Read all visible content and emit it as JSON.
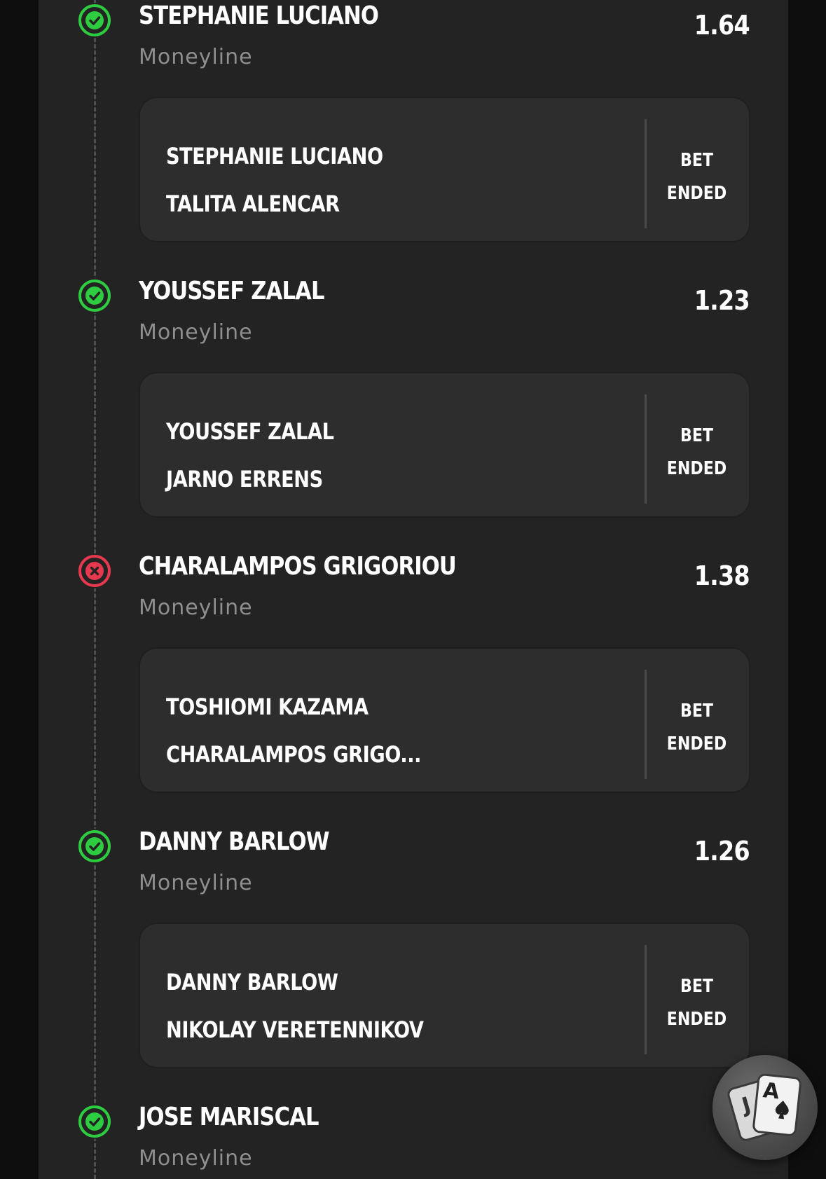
{
  "legs": [
    {
      "status": "won",
      "status_icon": "check-circle-icon",
      "pick": "STEPHANIE LUCIANO",
      "market": "Moneyline",
      "odds": "1.64",
      "fighter_1": "STEPHANIE LUCIANO",
      "fighter_2": "TALITA ALENCAR",
      "bet_status_line1": "BET",
      "bet_status_line2": "ENDED"
    },
    {
      "status": "won",
      "status_icon": "check-circle-icon",
      "pick": "YOUSSEF ZALAL",
      "market": "Moneyline",
      "odds": "1.23",
      "fighter_1": "YOUSSEF ZALAL",
      "fighter_2": "JARNO ERRENS",
      "bet_status_line1": "BET",
      "bet_status_line2": "ENDED"
    },
    {
      "status": "lost",
      "status_icon": "x-circle-icon",
      "pick": "CHARALAMPOS GRIGORIOU",
      "market": "Moneyline",
      "odds": "1.38",
      "fighter_1": "TOSHIOMI KAZAMA",
      "fighter_2": "CHARALAMPOS GRIGO...",
      "bet_status_line1": "BET",
      "bet_status_line2": "ENDED"
    },
    {
      "status": "won",
      "status_icon": "check-circle-icon",
      "pick": "DANNY BARLOW",
      "market": "Moneyline",
      "odds": "1.26",
      "fighter_1": "DANNY BARLOW",
      "fighter_2": "NIKOLAY VERETENNIKOV",
      "bet_status_line1": "BET",
      "bet_status_line2": "ENDED"
    },
    {
      "status": "won",
      "status_icon": "check-circle-icon",
      "pick": "JOSE MARISCAL",
      "market": "Moneyline",
      "odds": "1.",
      "fighter_1": "",
      "fighter_2": "",
      "bet_status_line1": "",
      "bet_status_line2": ""
    }
  ],
  "colors": {
    "won": "#2ecc40",
    "lost": "#e8384f"
  },
  "fab": {
    "icon": "playing-cards-icon",
    "card_back": "J",
    "card_front": "A"
  }
}
